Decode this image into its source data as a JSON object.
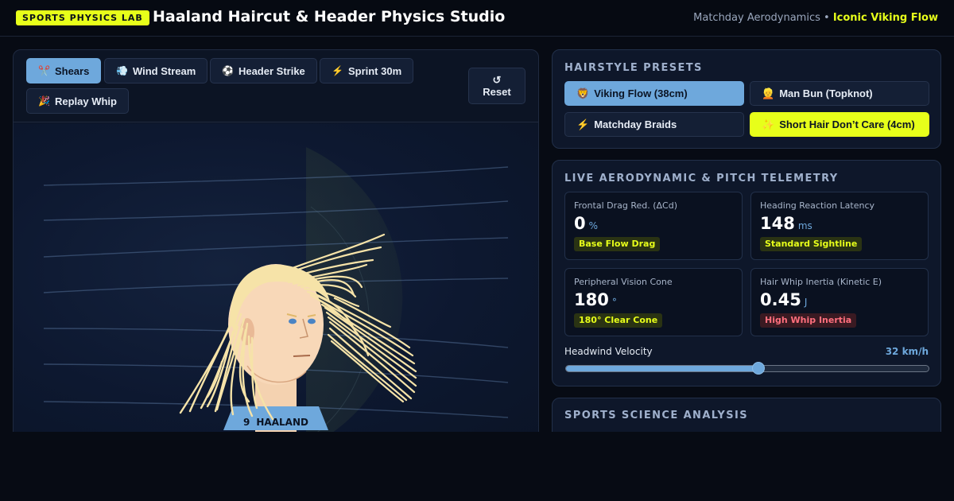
{
  "header": {
    "badge": "SPORTS PHYSICS LAB",
    "title": "Haaland Haircut & Header Physics Studio",
    "subtitle_prefix": "Matchday Aerodynamics",
    "separator": "•",
    "subtitle_accent": "Iconic Viking Flow"
  },
  "toolbar": {
    "tools": [
      {
        "label": "Shears",
        "icon": "✂️",
        "icon_name": "scissors-icon",
        "active": true
      },
      {
        "label": "Wind Stream",
        "icon": "💨",
        "icon_name": "wind-icon",
        "active": false
      },
      {
        "label": "Header Strike",
        "icon": "⚽",
        "icon_name": "soccer-ball-icon",
        "active": false
      },
      {
        "label": "Sprint 30m",
        "icon": "⚡",
        "icon_name": "lightning-icon",
        "active": false
      },
      {
        "label": "Replay Whip",
        "icon": "🎉",
        "icon_name": "party-popper-icon",
        "active": false
      }
    ],
    "reset_icon": "↺",
    "reset_label": "Reset"
  },
  "stage": {
    "jersey_number": "9",
    "jersey_name": "HAALAND"
  },
  "presets": {
    "title": "HAIRSTYLE PRESETS",
    "items": [
      {
        "label": "Viking Flow (38cm)",
        "icon": "🦁",
        "icon_name": "lion-icon",
        "state": "active"
      },
      {
        "label": "Man Bun (Topknot)",
        "icon": "👱",
        "icon_name": "person-blond-icon",
        "state": "default"
      },
      {
        "label": "Matchday Braids",
        "icon": "⚡",
        "icon_name": "lightning-icon",
        "state": "default"
      },
      {
        "label": "Short Hair Don’t Care (4cm)",
        "icon": "✨",
        "icon_name": "sparkles-icon",
        "state": "highlight"
      }
    ]
  },
  "telemetry": {
    "title": "LIVE AERODYNAMIC & PITCH TELEMETRY",
    "metrics": [
      {
        "label": "Frontal Drag Red. (ΔCd)",
        "value": "0",
        "unit": "%",
        "tag": "Base Flow Drag",
        "tag_color": "lime"
      },
      {
        "label": "Heading Reaction Latency",
        "value": "148",
        "unit": "ms",
        "tag": "Standard Sightline",
        "tag_color": "lime"
      },
      {
        "label": "Peripheral Vision Cone",
        "value": "180",
        "unit": "°",
        "tag": "180° Clear Cone",
        "tag_color": "lime"
      },
      {
        "label": "Hair Whip Inertia (Kinetic E)",
        "value": "0.45",
        "unit": "J",
        "tag": "High Whip Inertia",
        "tag_color": "red"
      }
    ],
    "slider": {
      "label": "Headwind Velocity",
      "value_text": "32 km/h",
      "fraction": 0.53
    }
  },
  "analysis": {
    "title": "SPORTS SCIENCE ANALYSIS"
  },
  "colors": {
    "accent_blue": "#6ea8dc",
    "accent_lime": "#e7ff1a",
    "warning_red": "#ff6f7d",
    "background": "#070b14"
  }
}
